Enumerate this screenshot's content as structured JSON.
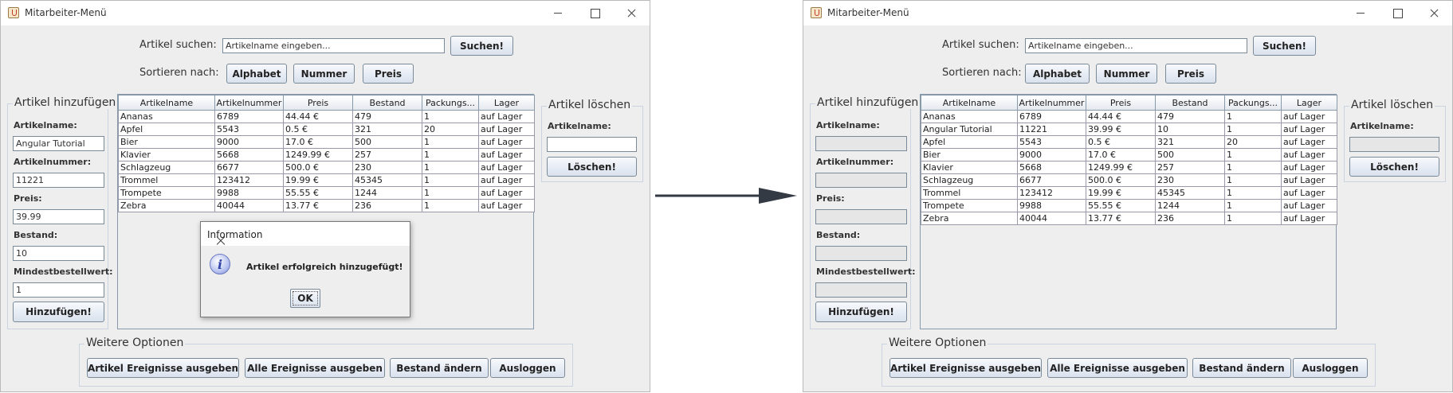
{
  "window_title": "Mitarbeiter-Menü",
  "search": {
    "label": "Artikel suchen:",
    "placeholder": "Artikelname eingeben...",
    "button": "Suchen!"
  },
  "sort": {
    "label": "Sortieren nach:",
    "buttons": [
      "Alphabet",
      "Nummer",
      "Preis"
    ]
  },
  "add_panel": {
    "title": "Artikel hinzufügen",
    "labels": [
      "Artikelname:",
      "Artikelnummer:",
      "Preis:",
      "Bestand:",
      "Mindestbestellwert:"
    ],
    "button": "Hinzufügen!"
  },
  "add_values_left": [
    "Angular Tutorial",
    "11221",
    "39.99",
    "10",
    "1"
  ],
  "delete_panel": {
    "title": "Artikel löschen",
    "label": "Artikelname:",
    "button": "Löschen!"
  },
  "table": {
    "columns": [
      "Artikelname",
      "Artikelnummer",
      "Preis",
      "Bestand",
      "Packungs...",
      "Lager"
    ],
    "rows_left": [
      [
        "Ananas",
        "6789",
        "44.44 €",
        "479",
        "1",
        "auf Lager"
      ],
      [
        "Apfel",
        "5543",
        "0.5 €",
        "321",
        "20",
        "auf Lager"
      ],
      [
        "Bier",
        "9000",
        "17.0 €",
        "500",
        "1",
        "auf Lager"
      ],
      [
        "Klavier",
        "5668",
        "1249.99 €",
        "257",
        "1",
        "auf Lager"
      ],
      [
        "Schlagzeug",
        "6677",
        "500.0 €",
        "230",
        "1",
        "auf Lager"
      ],
      [
        "Trommel",
        "123412",
        "19.99 €",
        "45345",
        "1",
        "auf Lager"
      ],
      [
        "Trompete",
        "9988",
        "55.55 €",
        "1244",
        "1",
        "auf Lager"
      ],
      [
        "Zebra",
        "40044",
        "13.77 €",
        "236",
        "1",
        "auf Lager"
      ]
    ],
    "rows_right": [
      [
        "Ananas",
        "6789",
        "44.44 €",
        "479",
        "1",
        "auf Lager"
      ],
      [
        "Angular Tutorial",
        "11221",
        "39.99 €",
        "10",
        "1",
        "auf Lager"
      ],
      [
        "Apfel",
        "5543",
        "0.5 €",
        "321",
        "20",
        "auf Lager"
      ],
      [
        "Bier",
        "9000",
        "17.0 €",
        "500",
        "1",
        "auf Lager"
      ],
      [
        "Klavier",
        "5668",
        "1249.99 €",
        "257",
        "1",
        "auf Lager"
      ],
      [
        "Schlagzeug",
        "6677",
        "500.0 €",
        "230",
        "1",
        "auf Lager"
      ],
      [
        "Trommel",
        "123412",
        "19.99 €",
        "45345",
        "1",
        "auf Lager"
      ],
      [
        "Trompete",
        "9988",
        "55.55 €",
        "1244",
        "1",
        "auf Lager"
      ],
      [
        "Zebra",
        "40044",
        "13.77 €",
        "236",
        "1",
        "auf Lager"
      ]
    ]
  },
  "options": {
    "title": "Weitere Optionen",
    "buttons": [
      "Artikel Ereignisse ausgeben",
      "Alle Ereignisse ausgeben",
      "Bestand ändern",
      "Ausloggen"
    ]
  },
  "dialog": {
    "title": "Information",
    "message": "Artikel erfolgreich hinzugefügt!",
    "ok": "OK"
  }
}
